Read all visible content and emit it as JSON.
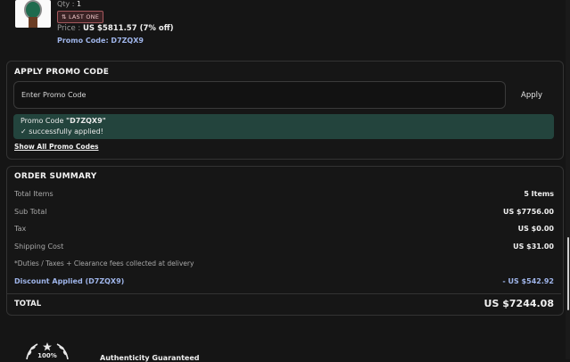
{
  "product": {
    "qty_label": "Qty :",
    "qty_value": "1",
    "badge": "LAST ONE",
    "price_label": "Price :",
    "price_value": "US $5811.57 (7% off)",
    "promo_line": "Promo Code: D7ZQX9"
  },
  "promo": {
    "title": "APPLY PROMO CODE",
    "placeholder": "Enter Promo Code",
    "apply_label": "Apply",
    "success_prefix": "Promo Code",
    "success_code": "\"D7ZQX9\"",
    "success_message": "successfully applied!",
    "show_all": "Show All Promo Codes"
  },
  "summary": {
    "title": "ORDER SUMMARY",
    "total_items_label": "Total Items",
    "total_items_value": "5 Items",
    "subtotal_label": "Sub Total",
    "subtotal_value": "US $7756.00",
    "tax_label": "Tax",
    "tax_value": "US $0.00",
    "shipping_label": "Shipping Cost",
    "shipping_value": "US $31.00",
    "duties_note": "*Duties / Taxes + Clearance fees collected at delivery",
    "discount_label": "Discount Applied (D7ZQX9)",
    "discount_value": "- US $542.92",
    "total_label": "TOTAL",
    "total_value": "US $7244.08"
  },
  "badge_bottom": {
    "seal_text": "100%",
    "authenticity": "Authenticity Guaranteed"
  },
  "colors": {
    "background": "#151515",
    "accent_blue": "#9fb5ea",
    "success_bg": "#23443d",
    "badge_border": "#a5585d"
  }
}
